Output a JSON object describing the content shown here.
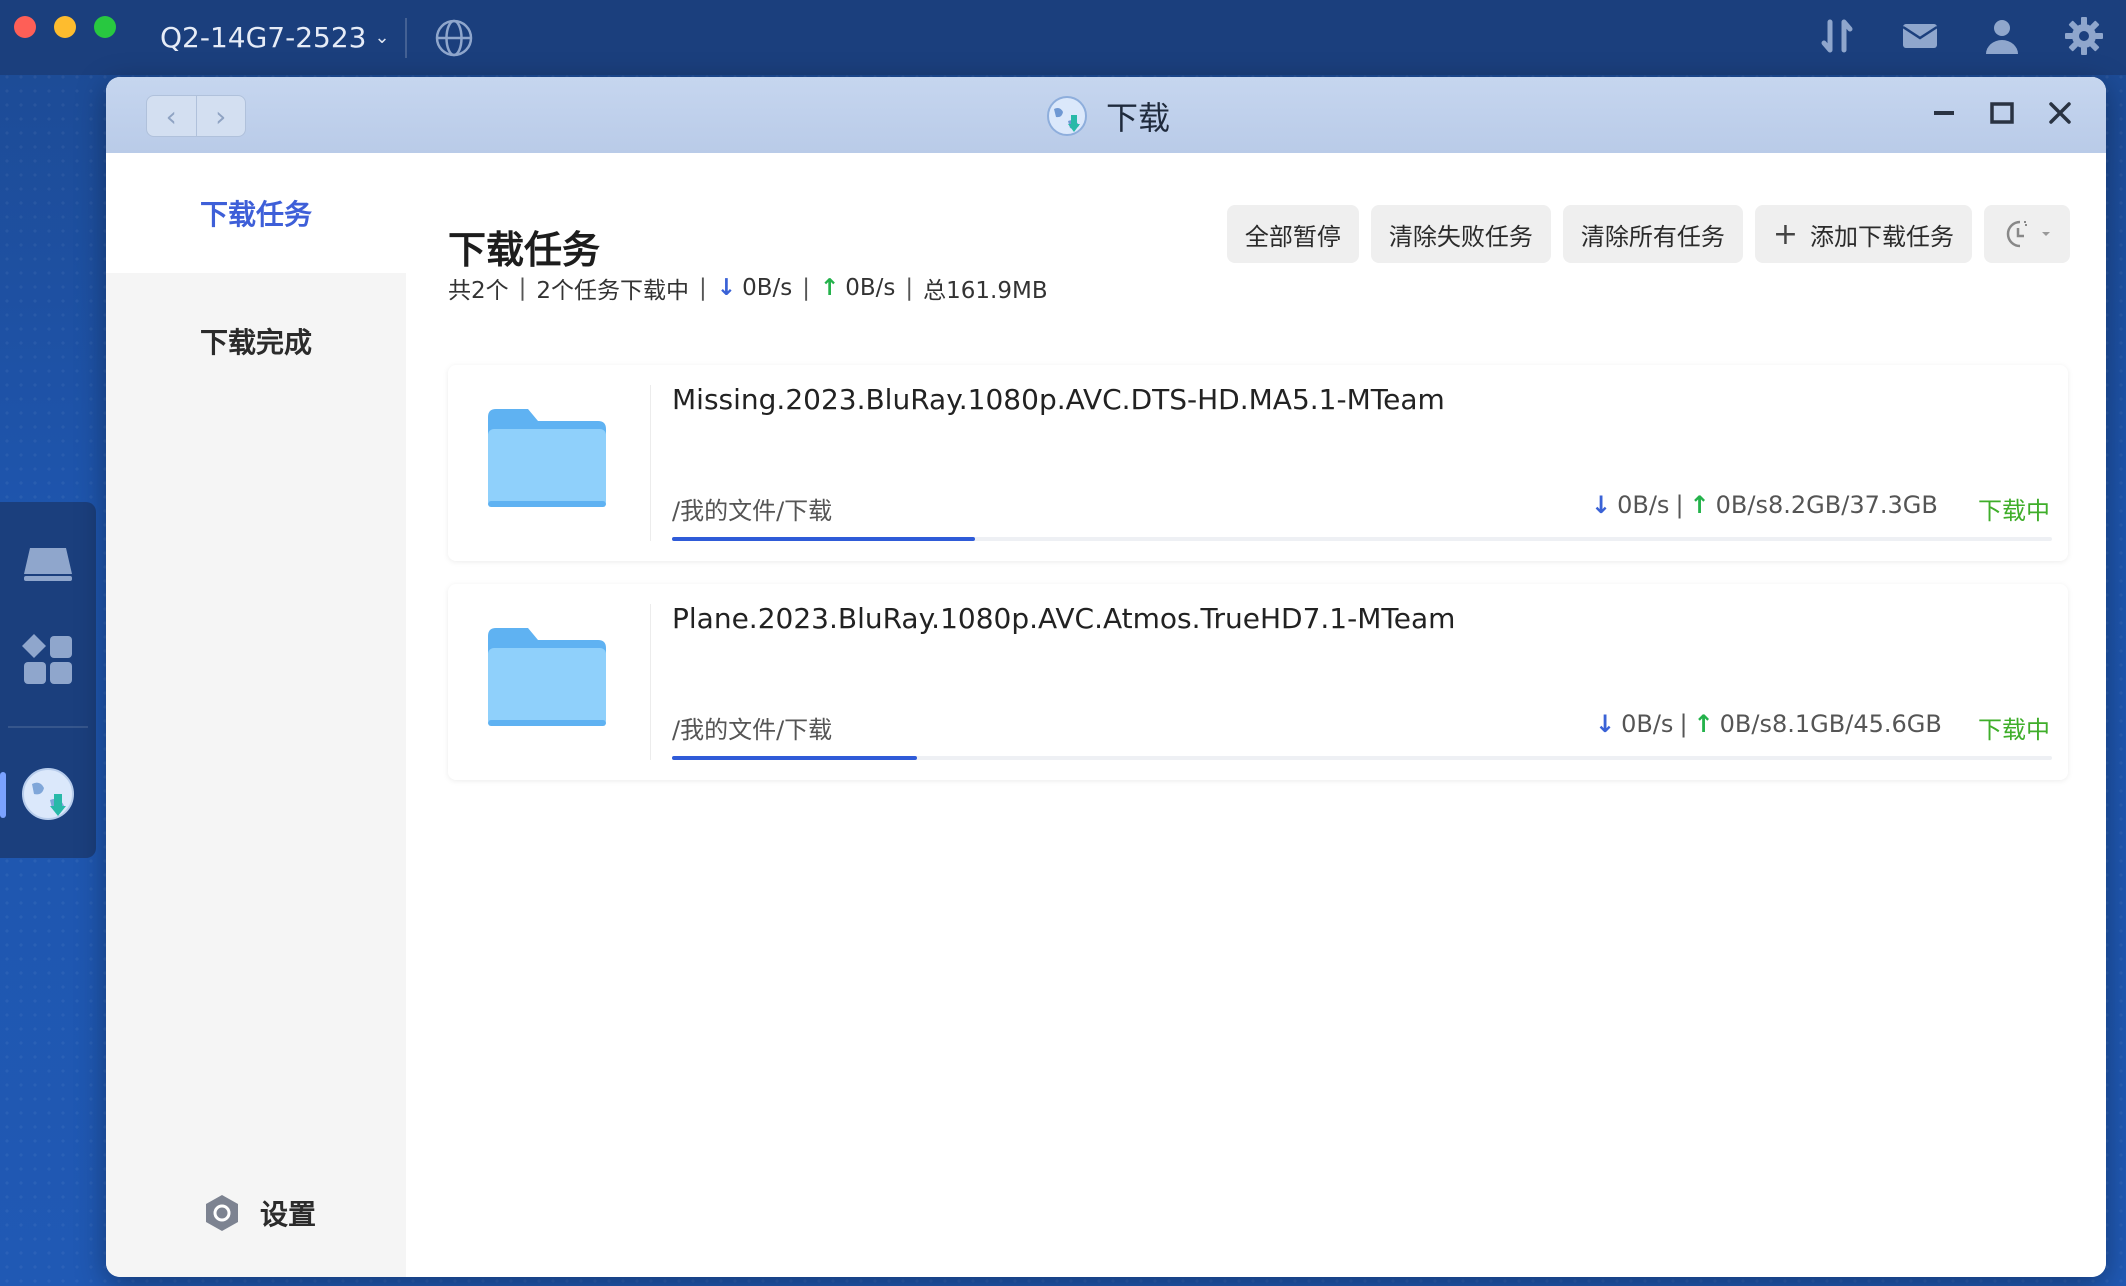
{
  "os": {
    "device_name": "Q2-14G7-2523",
    "icons": [
      "transfer-icon",
      "mail-icon",
      "user-icon",
      "gear-icon"
    ]
  },
  "window": {
    "title": "下载",
    "nav_back": "‹",
    "nav_forward": "›"
  },
  "sidebar": {
    "items": [
      {
        "label": "下载任务",
        "active": true
      },
      {
        "label": "下载完成",
        "active": false
      }
    ],
    "settings_label": "设置"
  },
  "main": {
    "title": "下载任务",
    "summary": {
      "total": "共2个",
      "downloading": "2个任务下载中",
      "down_speed": "0B/s",
      "up_speed": "0B/s",
      "total_size": "总161.9MB"
    },
    "toolbar": {
      "pause_all": "全部暂停",
      "clear_failed": "清除失败任务",
      "clear_all": "清除所有任务",
      "add_task": "添加下载任务"
    },
    "tasks": [
      {
        "name": "Missing.2023.BluRay.1080p.AVC.DTS-HD.MA5.1-MTeam",
        "path": "/我的文件/下载",
        "down_speed": "0B/s",
        "up_speed": "0B/s",
        "size": "8.2GB/37.3GB",
        "status": "下载中",
        "progress": 0.2198
      },
      {
        "name": "Plane.2023.BluRay.1080p.AVC.Atmos.TrueHD7.1-MTeam",
        "path": "/我的文件/下载",
        "down_speed": "0B/s",
        "up_speed": "0B/s",
        "size": "8.1GB/45.6GB",
        "status": "下载中",
        "progress": 0.1776
      }
    ]
  },
  "colors": {
    "accent": "#3e5fd8",
    "progress": "#2f5bd8",
    "status_green": "#3fae2a"
  }
}
